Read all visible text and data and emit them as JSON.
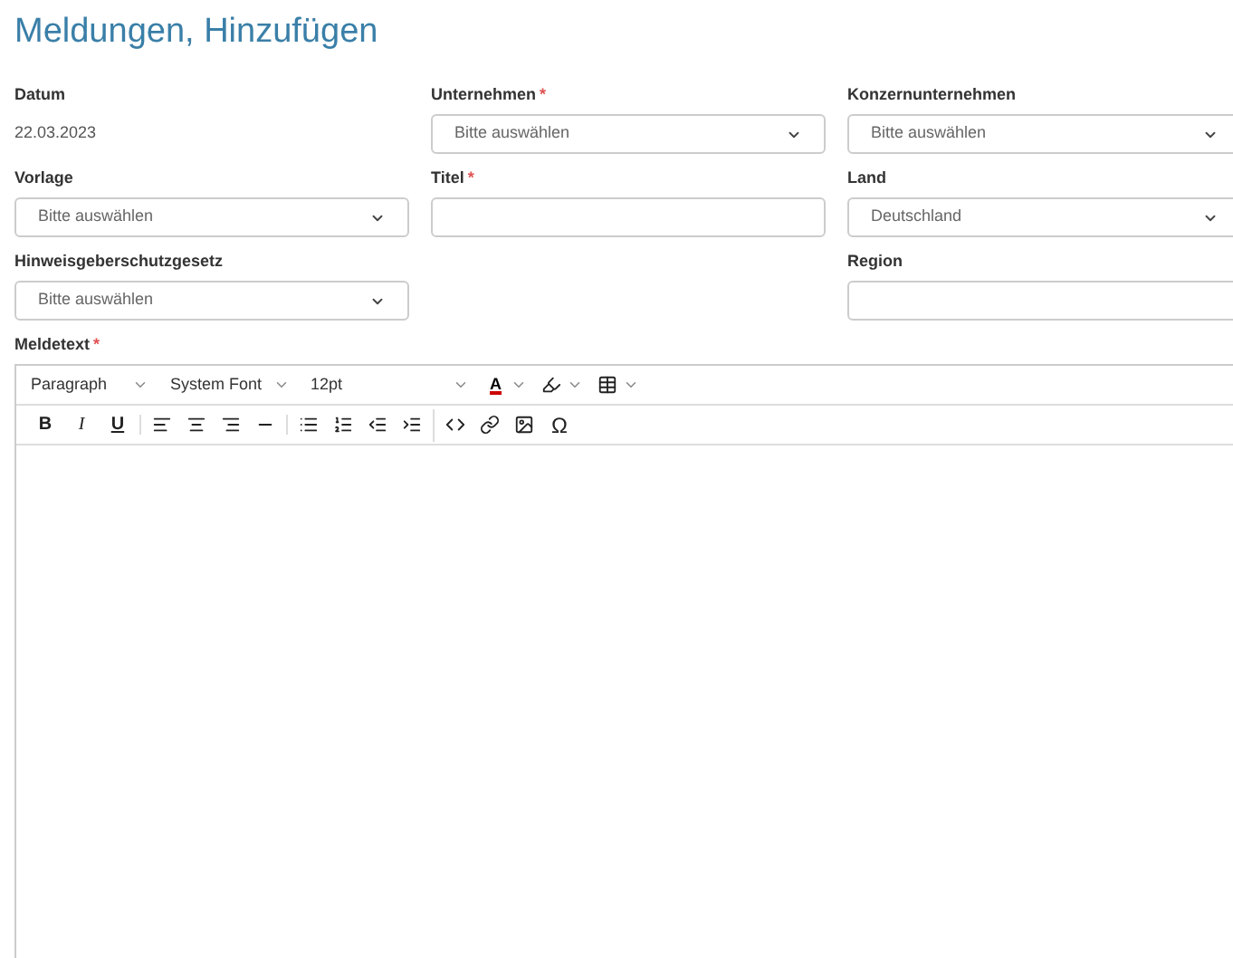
{
  "page_title": "Meldungen, Hinzufügen",
  "rows": [
    [
      {
        "kind": "static",
        "label": "Datum",
        "value": "22.03.2023"
      },
      {
        "kind": "select",
        "label": "Unternehmen",
        "required_mark": "*",
        "value": "Bitte auswählen"
      },
      {
        "kind": "select",
        "label": "Konzernunternehmen",
        "value": "Bitte auswählen"
      }
    ],
    [
      {
        "kind": "select",
        "label": "Vorlage",
        "value": "Bitte auswählen"
      },
      {
        "kind": "input",
        "label": "Titel",
        "required_mark": "*"
      },
      {
        "kind": "select",
        "label": "Land",
        "value": "Deutschland"
      }
    ],
    [
      {
        "kind": "select",
        "label": "Hinweisgeberschutzgesetz",
        "value": "Bitte auswählen"
      },
      {
        "kind": "empty"
      },
      {
        "kind": "input",
        "label": "Region"
      }
    ]
  ],
  "editor": {
    "label": "Meldetext",
    "required_mark": "*",
    "toolbar_1": [
      {
        "kind": "dropdown",
        "label": "Paragraph"
      },
      {
        "kind": "dropdown",
        "label": "System Font"
      },
      {
        "kind": "dropdown",
        "label": "12pt"
      },
      {
        "kind": "textcolor",
        "label": "A"
      },
      {
        "kind": "highlight"
      },
      {
        "kind": "table"
      }
    ],
    "toolbar_2": [
      [
        {
          "kind": "char",
          "label": "B"
        },
        {
          "kind": "char",
          "label": "I"
        },
        {
          "kind": "char",
          "label": "U"
        }
      ],
      [
        {
          "kind": "icon"
        },
        {
          "kind": "icon"
        },
        {
          "kind": "icon"
        },
        {
          "kind": "icon"
        }
      ],
      [
        {
          "kind": "icon"
        },
        {
          "kind": "icon"
        },
        {
          "kind": "icon"
        },
        {
          "kind": "icon"
        }
      ],
      [
        {
          "kind": "icon"
        },
        {
          "kind": "icon"
        },
        {
          "kind": "icon"
        },
        {
          "kind": "char",
          "label": "Ω"
        }
      ]
    ]
  }
}
